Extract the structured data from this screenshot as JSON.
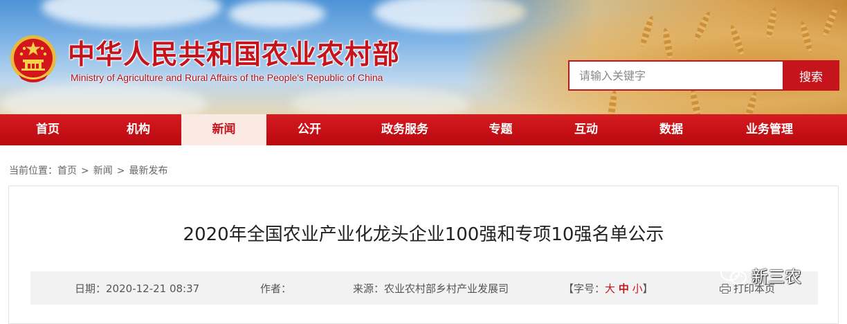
{
  "header": {
    "title_cn": "中华人民共和国农业农村部",
    "title_en": "Ministry of Agriculture and Rural Affairs of the People's Republic of China"
  },
  "search": {
    "placeholder": "请输入关键字",
    "button_label": "搜索"
  },
  "nav": {
    "items": [
      {
        "label": "首页"
      },
      {
        "label": "机构"
      },
      {
        "label": "新闻"
      },
      {
        "label": "公开"
      },
      {
        "label": "政务服务"
      },
      {
        "label": "专题"
      },
      {
        "label": "互动"
      },
      {
        "label": "数据"
      },
      {
        "label": "业务管理"
      }
    ],
    "active": "新闻"
  },
  "breadcrumb": {
    "prefix": "当前位置：",
    "items": [
      "首页",
      "新闻",
      "最新发布"
    ],
    "separator": ">"
  },
  "article": {
    "title": "2020年全国农业产业化龙头企业100强和专项10强名单公示",
    "meta": {
      "date_label": "日期：",
      "date_value": "2020-12-21 08:37",
      "author_label": "作者：",
      "author_value": "",
      "source_label": "来源：",
      "source_value": "农业农村部乡村产业发展司",
      "fontsize_open": "【字号：",
      "fontsize_large": "大",
      "fontsize_medium": "中",
      "fontsize_small": "小",
      "fontsize_close": "】",
      "print_label": "打印本页"
    }
  },
  "watermark": {
    "text": "新三农"
  },
  "colors": {
    "brand_red": "#c5141b",
    "active_tab_bg": "#fbe9e4",
    "meta_bar_bg": "#f2f2f2"
  }
}
